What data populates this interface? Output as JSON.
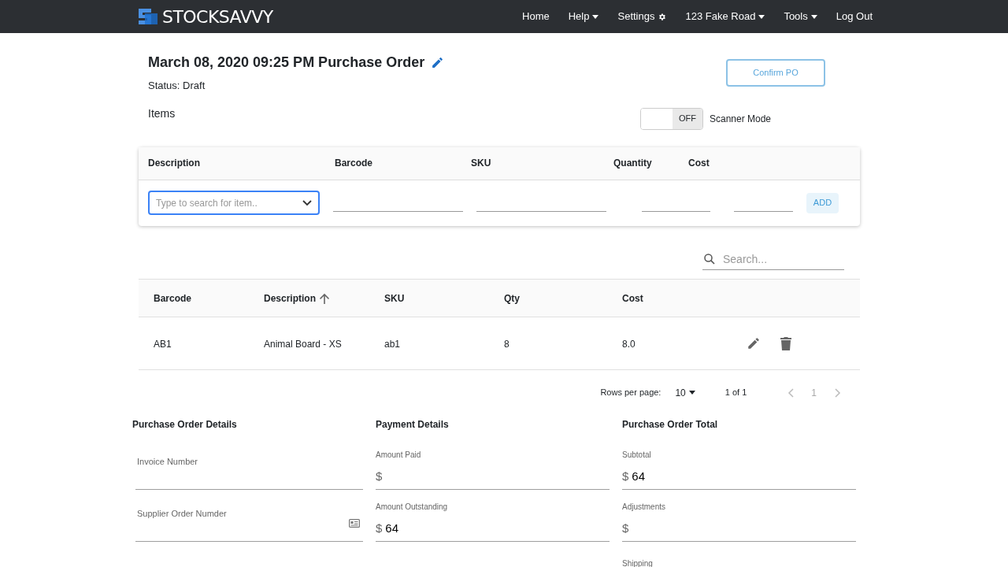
{
  "navbar": {
    "brand": "STOCKSAVVY",
    "items": [
      {
        "label": "Home",
        "kind": "link"
      },
      {
        "label": "Help",
        "kind": "dropdown"
      },
      {
        "label": "Settings",
        "kind": "settings"
      },
      {
        "label": "123 Fake Road",
        "kind": "dropdown"
      },
      {
        "label": "Tools",
        "kind": "dropdown"
      },
      {
        "label": "Log Out",
        "kind": "link"
      }
    ]
  },
  "header": {
    "title": "March 08, 2020 09:25 PM Purchase Order",
    "status": "Status: Draft",
    "confirm_button": "Confirm PO"
  },
  "items_section": {
    "title": "Items",
    "scanner": {
      "label": "Scanner Mode",
      "state_text": "OFF",
      "on": false
    }
  },
  "add_form": {
    "columns": [
      "Description",
      "Barcode",
      "SKU",
      "Quantity",
      "Cost"
    ],
    "description_placeholder": "Type to search for item..",
    "add_button": "ADD"
  },
  "table": {
    "search_placeholder": "Search...",
    "columns": [
      {
        "label": "Barcode",
        "sorted": false
      },
      {
        "label": "Description",
        "sorted": true
      },
      {
        "label": "SKU",
        "sorted": false
      },
      {
        "label": "Qty",
        "sorted": false
      },
      {
        "label": "Cost",
        "sorted": false
      }
    ],
    "rows": [
      [
        "AB1",
        "Animal Board - XS",
        "ab1",
        "8",
        "8.0"
      ]
    ],
    "pagination": {
      "rows_label": "Rows per page:",
      "rows_value": "10",
      "range": "1 of 1",
      "page": "1"
    }
  },
  "details": [
    {
      "title": "Purchase Order Details",
      "fields": [
        {
          "label": "Invoice Number",
          "kind": "plain"
        },
        {
          "label": "Supplier Order Numder",
          "kind": "card"
        }
      ]
    },
    {
      "title": "Payment Details",
      "fields": [
        {
          "label": "Amount Paid",
          "kind": "money",
          "prefix": "$"
        },
        {
          "label": "Amount Outstanding",
          "kind": "money",
          "prefix": "$",
          "value": "64"
        }
      ]
    },
    {
      "title": "Purchase Order Total",
      "fields": [
        {
          "label": "Subtotal",
          "kind": "money",
          "prefix": "$",
          "value": "64"
        },
        {
          "label": "Adjustments",
          "kind": "money",
          "prefix": "$"
        },
        {
          "label": "Shipping",
          "kind": "cut"
        }
      ]
    }
  ]
}
